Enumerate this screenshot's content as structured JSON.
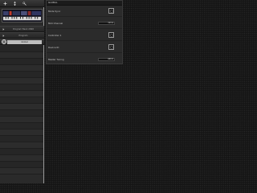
{
  "toolbar": {
    "icons": [
      "add-icon",
      "move-icon",
      "settings-icon"
    ]
  },
  "sidebar": {
    "rows": [
      {
        "label": "Program Bank 2998"
      },
      {
        "label": "Program"
      },
      {
        "label": "Global"
      }
    ]
  },
  "panel": {
    "title": "GLOBAL",
    "settings": [
      {
        "label": "Mode Sync",
        "type": "checkbox",
        "checked": false
      },
      {
        "label": "Midi Channel",
        "type": "value",
        "value": "Omni"
      },
      {
        "label": "Controller 1",
        "type": "checkbox",
        "checked": false
      },
      {
        "label": "Device ID",
        "type": "checkbox",
        "checked": false
      },
      {
        "label": "Master Tuning",
        "type": "value",
        "value": "440.0"
      }
    ]
  },
  "colors": {
    "background": "#141414",
    "sidebar": "#2a2a2a",
    "panel": "#2b2b2b",
    "selected_row": "#bdbdbd"
  }
}
